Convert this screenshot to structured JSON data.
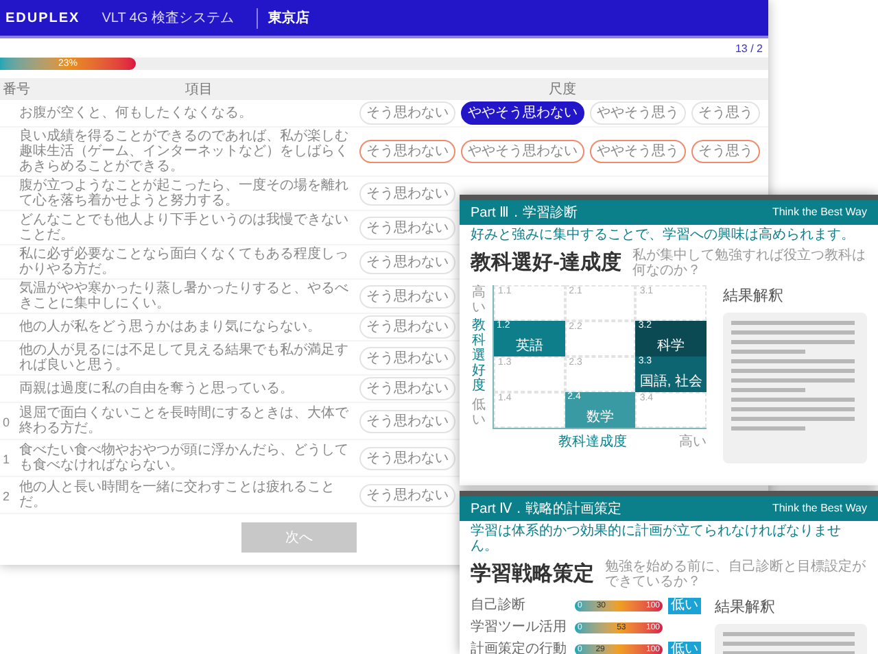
{
  "app": {
    "logo": "EDUPLEX",
    "title": "VLT 4G 検査システム",
    "branch": "東京店"
  },
  "progress": {
    "count": "13 / 2",
    "level": 0.23,
    "label": "23%"
  },
  "table": {
    "columns": [
      "番号",
      "項目",
      "尺度"
    ],
    "rows": [
      {
        "text": "お腹が空くと、何もしたくなくなる。",
        "highlighted": false,
        "options": [
          {
            "label": "そう思わない",
            "selected": false
          },
          {
            "label": "ややそう思わない",
            "selected": true
          },
          {
            "label": "ややそう思う",
            "selected": false
          },
          {
            "label": "そう思う",
            "selected": false
          }
        ]
      },
      {
        "text": "良い成績を得ることができるのであれば、私が楽しむ趣味生活（ゲーム、インターネットなど）をしばらくあきらめることができる。",
        "highlighted": true,
        "options": [
          {
            "label": "そう思わない",
            "selected": false
          },
          {
            "label": "ややそう思わない",
            "selected": false
          },
          {
            "label": "ややそう思う",
            "selected": false
          },
          {
            "label": "そう思う",
            "selected": false
          }
        ]
      },
      {
        "text": "腹が立つようなことが起こったら、一度その場を離れて心を落ち着かせようと努力する。",
        "highlighted": false,
        "options": [
          {
            "label": "そう思わない",
            "selected": false
          }
        ]
      },
      {
        "text": "どんなことでも他人より下手というのは我慢できないことだ。",
        "highlighted": false,
        "options": [
          {
            "label": "そう思わない",
            "selected": false
          }
        ]
      },
      {
        "text": "私に必ず必要なことなら面白くなくてもある程度しっかりやる方だ。",
        "highlighted": false,
        "options": [
          {
            "label": "そう思わない",
            "selected": false
          }
        ]
      },
      {
        "text": "気温がやや寒かったり蒸し暑かったりすると、やるべきことに集中しにくい。",
        "highlighted": false,
        "options": [
          {
            "label": "そう思わない",
            "selected": false
          }
        ]
      },
      {
        "text": "他の人が私をどう思うかはあまり気にならない。",
        "highlighted": false,
        "options": [
          {
            "label": "そう思わない",
            "selected": false
          }
        ]
      },
      {
        "text": "他の人が見るには不足して見える結果でも私が満足すれば良いと思う。",
        "highlighted": false,
        "options": [
          {
            "label": "そう思わない",
            "selected": false
          }
        ]
      },
      {
        "text": "両親は過度に私の自由を奪うと思っている。",
        "highlighted": false,
        "options": [
          {
            "label": "そう思わない",
            "selected": false
          }
        ]
      },
      {
        "number": "0",
        "text": "退屈で面白くないことを長時間にするときは、大体で終わる方だ。",
        "highlighted": false,
        "options": [
          {
            "label": "そう思わない",
            "selected": false
          }
        ]
      },
      {
        "number": "1",
        "text": "食べたい食べ物やおやつが頭に浮かんだら、どうしても食べなければならない。",
        "highlighted": false,
        "options": [
          {
            "label": "そう思わない",
            "selected": false
          }
        ]
      },
      {
        "number": "2",
        "text": "他の人と長い時間を一緒に交わすことは疲れることだ。",
        "highlighted": false,
        "options": [
          {
            "label": "そう思わない",
            "selected": false
          }
        ]
      }
    ]
  },
  "next_button": "次へ",
  "reports": [
    {
      "kind": "matrix",
      "part": "Part Ⅲ．学習診断",
      "tagline": "好みと強みに集中することで、学習への興味は高められます。",
      "brand": "Think the Best Way",
      "title": "教科選好-達成度",
      "subtitle": "私が集中して勉強すれば役立つ教科は何なのか？",
      "result_title": "結果解釈",
      "axes": {
        "y_high": "高い",
        "y_label": "教科選好度",
        "low": "低い",
        "x_label": "教科達成度",
        "x_high": "高い"
      },
      "cells": [
        {
          "id": "1.1"
        },
        {
          "id": "2.1"
        },
        {
          "id": "3.1"
        },
        {
          "id": "1.2",
          "subject": "英語",
          "color": "#0e7f8a"
        },
        {
          "id": "2.2"
        },
        {
          "id": "3.2",
          "subject": "科学",
          "color": "#0b4a52"
        },
        {
          "id": "1.3"
        },
        {
          "id": "2.3"
        },
        {
          "id": "3.3",
          "subject": "国語, 社会",
          "color": "#0c6570"
        },
        {
          "id": "1.4"
        },
        {
          "id": "2.4",
          "subject": "数学",
          "color": "#3a9aa3"
        },
        {
          "id": "3.4"
        }
      ]
    },
    {
      "kind": "bars",
      "part": "Part Ⅳ．戦略的計画策定",
      "tagline": "学習は体系的かつ効果的に計画が立てられなければなりません。",
      "brand": "Think the Best Way",
      "title": "学習戦略策定",
      "subtitle": "勉強を始める前に、自己診断と目標設定ができているか？",
      "result_title": "結果解釈",
      "bars": [
        {
          "label": "自己診断",
          "min": "0",
          "max": "100",
          "value": "30",
          "level": 0.3,
          "badge": "低い"
        },
        {
          "label": "学習ツール活用",
          "min": "0",
          "max": "100",
          "value": "53",
          "level": 0.53
        },
        {
          "label": "計画策定の行動",
          "min": "0",
          "max": "100",
          "value": "29",
          "level": 0.29,
          "badge": "低い"
        }
      ]
    }
  ]
}
